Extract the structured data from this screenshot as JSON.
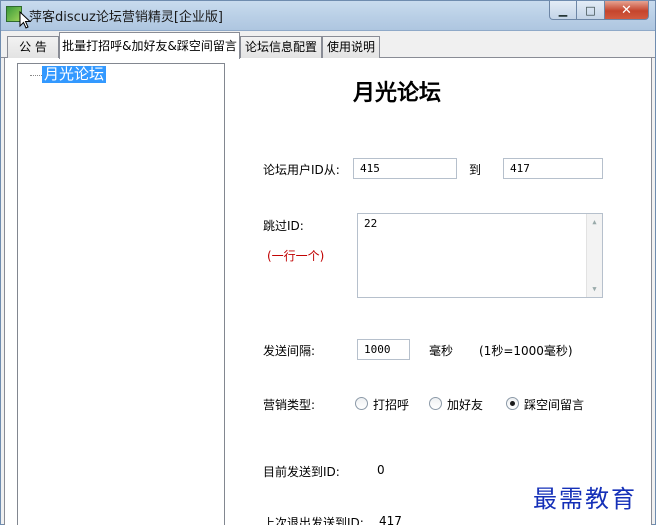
{
  "window": {
    "title": "萍客discuz论坛营销精灵[企业版]",
    "controls": {
      "minimize": "▁",
      "maximize": "□",
      "close": "✕"
    }
  },
  "tabs": [
    {
      "label": "公 告",
      "active": false
    },
    {
      "label": "批量打招呼&加好友&踩空间留言",
      "active": true
    },
    {
      "label": "论坛信息配置",
      "active": false
    },
    {
      "label": "使用说明",
      "active": false
    }
  ],
  "tree": {
    "nodes": [
      "月光论坛"
    ]
  },
  "panel": {
    "title": "月光论坛",
    "user_id_range": {
      "label": "论坛用户ID从:",
      "from": "415",
      "to_label": "到",
      "to": "417"
    },
    "skip_ids": {
      "label": "跳过ID:",
      "hint": "(一行一个)",
      "value": "22"
    },
    "interval": {
      "label": "发送间隔:",
      "value": "1000",
      "unit": "毫秒",
      "note": "(1秒=1000毫秒)"
    },
    "marketing_type": {
      "label": "营销类型:",
      "options": [
        "打招呼",
        "加好友",
        "踩空间留言"
      ],
      "selected": "踩空间留言"
    },
    "current_sent": {
      "label": "目前发送到ID:",
      "value": "0"
    },
    "last_exit": {
      "label": "上次退出发送到ID:",
      "value": "417"
    }
  },
  "watermark": "最需教育"
}
